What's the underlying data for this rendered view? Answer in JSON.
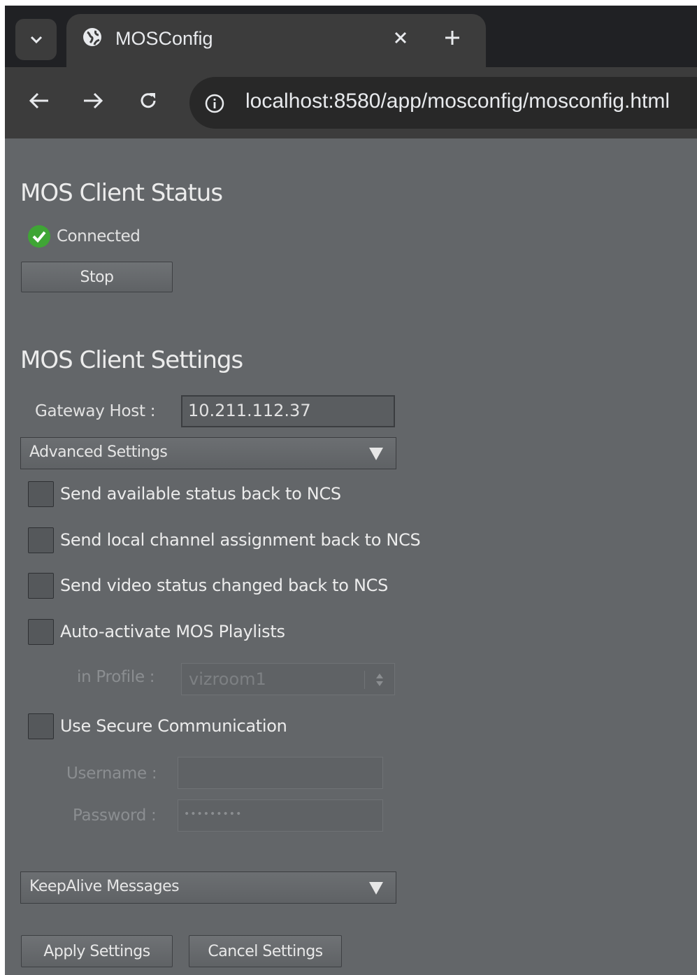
{
  "browser": {
    "tab_title": "MOSConfig",
    "url": "localhost:8580/app/mosconfig/mosconfig.html"
  },
  "status_section": {
    "title": "MOS Client Status",
    "status": "Connected",
    "stop_label": "Stop"
  },
  "settings_section": {
    "title": "MOS Client Settings",
    "gateway_host_label": "Gateway Host :",
    "gateway_host_value": "10.211.112.37",
    "advanced_label": "Advanced Settings",
    "options": [
      "Send available status back to NCS",
      "Send local channel assignment back to NCS",
      "Send video status changed back to NCS",
      "Auto-activate MOS Playlists"
    ],
    "profile_label": "in Profile :",
    "profile_value": "vizroom1",
    "secure_label": "Use Secure Communication",
    "username_label": "Username :",
    "username_value": "",
    "password_label": "Password :",
    "password_value": "•••••••••",
    "keepalive_label": "KeepAlive Messages",
    "apply_label": "Apply Settings",
    "cancel_label": "Cancel Settings"
  },
  "colors": {
    "page_bg": "#636669",
    "status_ok": "#3fa535"
  }
}
